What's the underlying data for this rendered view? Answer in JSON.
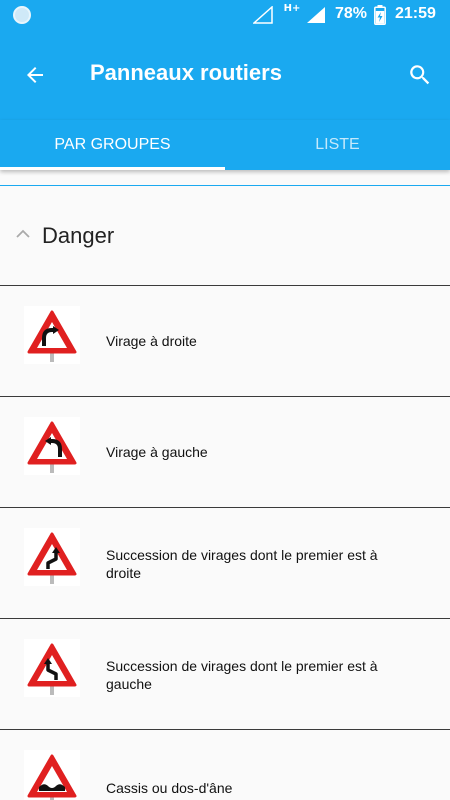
{
  "status_bar": {
    "network": "H+",
    "battery": "78%",
    "time": "21:59"
  },
  "app_bar": {
    "title": "Panneaux routiers"
  },
  "tabs": [
    {
      "label": "PAR GROUPES",
      "selected": true
    },
    {
      "label": "LISTE",
      "selected": false
    }
  ],
  "group": {
    "title": "Danger",
    "expanded": true
  },
  "signs": [
    {
      "label": "Virage à droite",
      "icon": "curve-right"
    },
    {
      "label": "Virage à gauche",
      "icon": "curve-left"
    },
    {
      "label": "Succession de virages dont le premier est à droite",
      "icon": "double-curve-right"
    },
    {
      "label": "Succession de virages dont le premier est à gauche",
      "icon": "double-curve-left"
    },
    {
      "label": "Cassis ou dos-d'âne",
      "icon": "bump"
    }
  ],
  "colors": {
    "primary": "#1aa9f0",
    "sign_red": "#e02020"
  }
}
